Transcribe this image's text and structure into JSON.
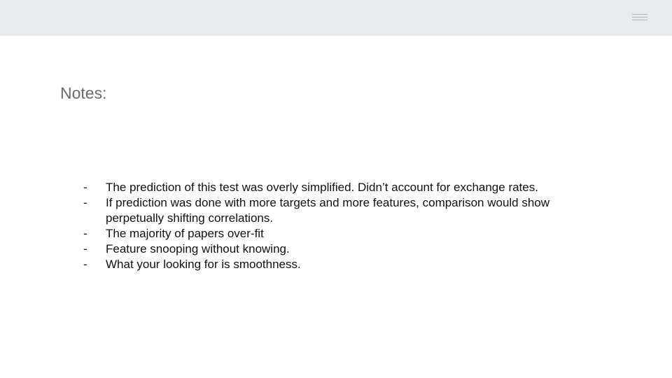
{
  "slide": {
    "title": "Notes:",
    "bullet_marker": "-",
    "bullets": [
      "The prediction of this test was overly simplified. Didn’t account for exchange rates.",
      "If prediction was done with more targets and more features, comparison would show perpetually shifting correlations.",
      "The majority of papers over-fit",
      "Feature snooping without knowing.",
      "What your looking for is smoothness."
    ]
  },
  "icons": {
    "menu": "hamburger-icon"
  },
  "colors": {
    "header_band": "#e8eaeb",
    "title_text": "#6b6b6b",
    "body_text": "#111111"
  }
}
